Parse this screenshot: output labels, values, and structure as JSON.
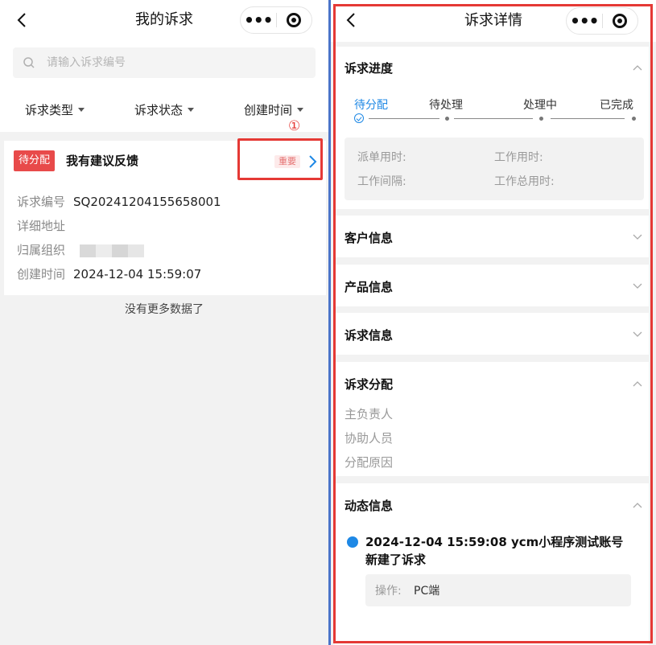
{
  "left": {
    "title": "我的诉求",
    "search": {
      "placeholder": "请输入诉求编号"
    },
    "filters": [
      {
        "label": "诉求类型"
      },
      {
        "label": "诉求状态"
      },
      {
        "label": "创建时间"
      }
    ],
    "marker": "①",
    "card": {
      "status_tag": "待分配",
      "title": "我有建议反馈",
      "priority_tag": "重要",
      "fields": [
        {
          "key": "诉求编号",
          "value": "SQ20241204155658001"
        },
        {
          "key": "详细地址",
          "value": ""
        },
        {
          "key": "归属组织",
          "value": ""
        },
        {
          "key": "创建时间",
          "value": "2024-12-04 15:59:07"
        }
      ]
    },
    "no_more": "没有更多数据了"
  },
  "right": {
    "title": "诉求详情",
    "progress": {
      "title": "诉求进度",
      "steps": [
        {
          "label": "待分配",
          "state": "active"
        },
        {
          "label": "待处理",
          "state": "pending"
        },
        {
          "label": "处理中",
          "state": "pending"
        },
        {
          "label": "已完成",
          "state": "pending"
        }
      ],
      "times": {
        "dispatch": "派单用时:",
        "work": "工作用时:",
        "interval": "工作间隔:",
        "total": "工作总用时:"
      }
    },
    "sections": {
      "customer": "客户信息",
      "product": "产品信息",
      "appeal": "诉求信息"
    },
    "assign": {
      "title": "诉求分配",
      "rows": [
        "主负责人",
        "协助人员",
        "分配原因"
      ]
    },
    "dynamic": {
      "title": "动态信息",
      "entry_line1": "2024-12-04 15:59:08  ycm小程序测试账号",
      "entry_line2": "新建了诉求",
      "op_key": "操作:",
      "op_value": "PC端"
    }
  },
  "colors": {
    "accent_blue": "#1e88e5",
    "status_red": "#e84a4a",
    "highlight_red": "#e53935",
    "panel_divider": "#4a74c9"
  }
}
